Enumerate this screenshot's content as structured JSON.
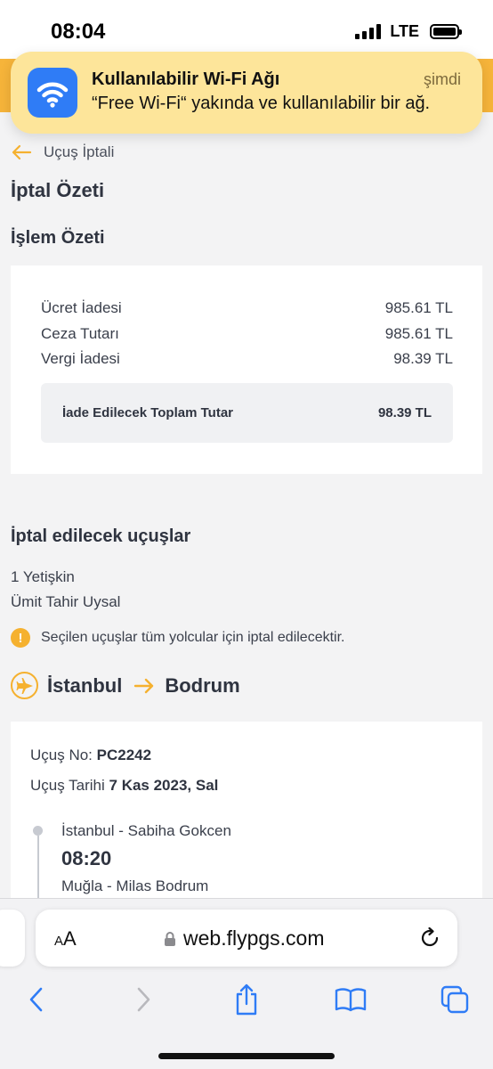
{
  "status_bar": {
    "time": "08:04",
    "network": "LTE"
  },
  "notification": {
    "title": "Kullanılabilir Wi-Fi Ağı",
    "time": "şimdi",
    "body": "“Free Wi-Fi“ yakında ve kullanılabilir bir ağ.",
    "icon": "wifi-icon"
  },
  "breadcrumb": {
    "label": "Uçuş İptali",
    "icon": "back-arrow-icon"
  },
  "page_title": "İptal Özeti",
  "summary": {
    "title": "İşlem Özeti",
    "rows": [
      {
        "label": "Ücret İadesi",
        "value": "985.61 TL"
      },
      {
        "label": "Ceza Tutarı",
        "value": "985.61 TL"
      },
      {
        "label": "Vergi İadesi",
        "value": "98.39 TL"
      }
    ],
    "total_label": "İade Edilecek Toplam Tutar",
    "total_value": "98.39 TL"
  },
  "flights": {
    "title": "İptal edilecek uçuşlar",
    "passenger_count": "1 Yetişkin",
    "passenger_name": "Ümit Tahir Uysal",
    "warning": "Seçilen uçuşlar tüm yolcular için iptal edilecektir.",
    "route_from": "İstanbul",
    "route_to": "Bodrum",
    "flight_no_label": "Uçuş No:",
    "flight_no": "PC2242",
    "date_label": "Uçuş Tarihi",
    "date": "7 Kas 2023, Sal",
    "departure_airport": "İstanbul - Sabiha Gokcen",
    "departure_time": "08:20",
    "arrival_airport": "Muğla - Milas Bodrum"
  },
  "browser": {
    "aa_label_small": "A",
    "aa_label_large": "A",
    "url": "web.flypgs.com"
  },
  "colors": {
    "brand": "#f6b43a",
    "accent": "#f5b12f",
    "ios_blue": "#2f7cf6"
  }
}
